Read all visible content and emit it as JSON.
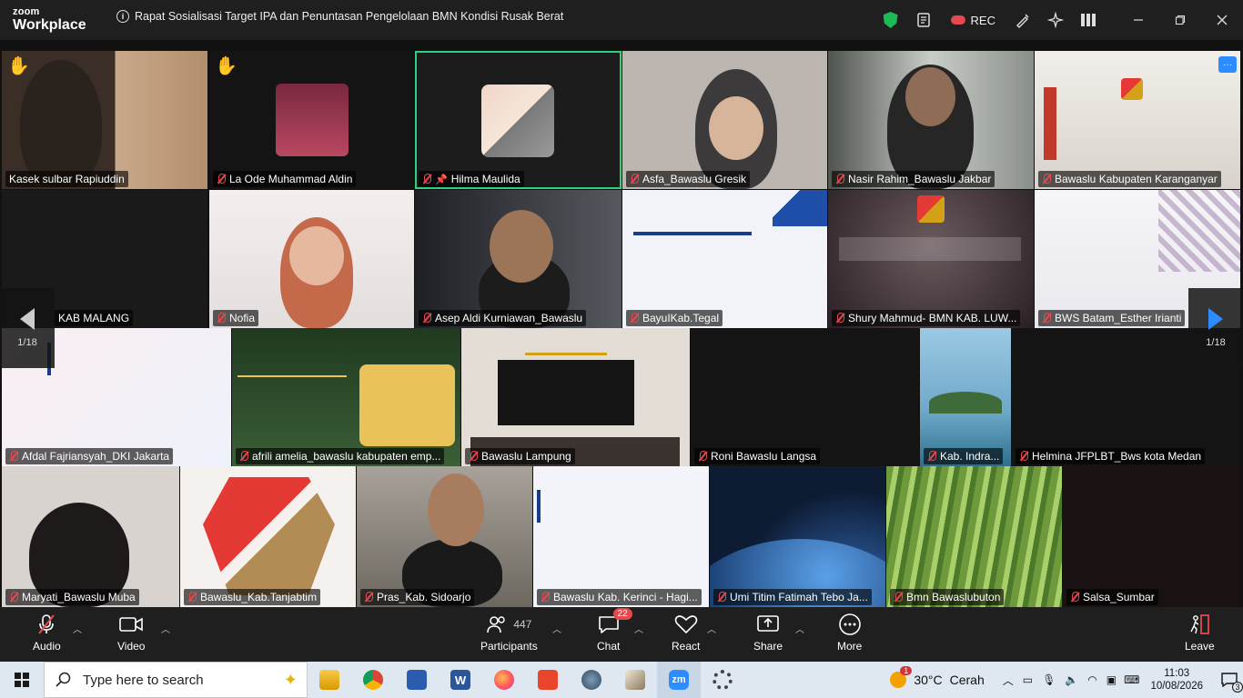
{
  "app": {
    "logo_top": "zoom",
    "logo_bottom": "Workplace"
  },
  "meeting": {
    "title": "Rapat Sosialisasi Target IPA dan Penuntasan Pengelolaan BMN Kondisi Rusak Berat"
  },
  "titlebar": {
    "rec_label": "REC"
  },
  "pagination": {
    "left": "1/18",
    "right": "1/18"
  },
  "participants": [
    {
      "name": "Kasek sulbar Rapiuddin",
      "muted": false,
      "hand": true,
      "bg": "#6d5a45"
    },
    {
      "name": "La Ode Muhammad Aldin",
      "muted": true,
      "hand": true,
      "bg": "#121212"
    },
    {
      "name": "Hilma Maulida",
      "muted": true,
      "pinned": true,
      "active": true,
      "bg": "#1c1c1c"
    },
    {
      "name": "Asfa_Bawaslu Gresik",
      "muted": true,
      "bg": "#bdb6b0"
    },
    {
      "name": "Nasir Rahim_Bawaslu Jakbar",
      "muted": true,
      "bg": "#9aa09c"
    },
    {
      "name": "Bawaslu Kabupaten Karanganyar",
      "muted": true,
      "bg": "#e6e2dd"
    },
    {
      "name": "KAB MALANG",
      "muted": false,
      "bg": "#1a1a1a"
    },
    {
      "name": "Nofia",
      "muted": true,
      "bg": "#e9e4e2"
    },
    {
      "name": "Asep Aldi Kurniawan_Bawaslu",
      "muted": true,
      "bg": "#3c3f45"
    },
    {
      "name": "BayuIKab.Tegal",
      "muted": true,
      "bg": "#f1f3f8"
    },
    {
      "name": "Shury Mahmud- BMN KAB. LUW...",
      "muted": true,
      "bg": "#3a3033"
    },
    {
      "name": "BWS Batam_Esther Irianti",
      "muted": true,
      "bg": "#f0f0f3"
    },
    {
      "name": "Afdal Fajriansyah_DKI Jakarta",
      "muted": true,
      "bg": "#f3f0f6"
    },
    {
      "name": "afrili amelia_bawaslu kabupaten emp...",
      "muted": true,
      "bg": "#2e4a2e"
    },
    {
      "name": "Bawaslu Lampung",
      "muted": true,
      "bg": "#e3ddd5"
    },
    {
      "name": "Roni Bawaslu Langsa",
      "muted": true,
      "bg": "#141414"
    },
    {
      "name": "Kab. Indra...",
      "muted": true,
      "bg": "#6fa9c9"
    },
    {
      "name": "Helmina JFPLBT_Bws kota Medan",
      "muted": true,
      "bg": "#141414"
    },
    {
      "name": "Maryati_Bawaslu Muba",
      "muted": true,
      "bg": "#d9d3cf"
    },
    {
      "name": "Bawaslu_Kab.Tanjabtim",
      "muted": true,
      "bg": "#f4f1ef"
    },
    {
      "name": "Pras_Kab. Sidoarjo",
      "muted": true,
      "bg": "#8a857d"
    },
    {
      "name": "Bawaslu Kab. Kerinci - Hagi...",
      "muted": true,
      "bg": "#f2f4fa"
    },
    {
      "name": "Umi Titim Fatimah Tebo Ja...",
      "muted": true,
      "bg": "#0d1b33"
    },
    {
      "name": "Bmn Bawaslubuton",
      "muted": true,
      "bg": "#7fa94a"
    },
    {
      "name": "Salsa_Sumbar",
      "muted": true,
      "bg": "#1a1212"
    }
  ],
  "toolbar": {
    "audio": "Audio",
    "video": "Video",
    "participants": "Participants",
    "participants_count": "447",
    "chat": "Chat",
    "chat_badge": "22",
    "react": "React",
    "share": "Share",
    "more": "More",
    "leave": "Leave"
  },
  "taskbar": {
    "search_placeholder": "Type here to search",
    "weather_temp": "30°C",
    "weather_desc": "Cerah",
    "weather_badge": "1",
    "time": "11:03",
    "date": "10/08/2026",
    "notif_count": "3"
  }
}
